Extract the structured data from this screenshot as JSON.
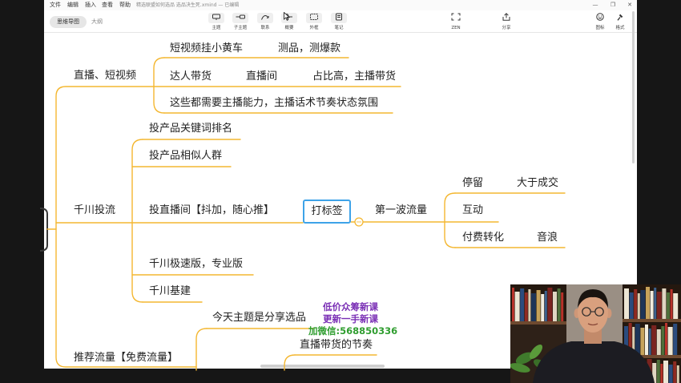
{
  "window": {
    "menu": [
      "文件",
      "编辑",
      "插入",
      "查看",
      "帮助"
    ],
    "title": "精选联盟如何选品 选品决生死.xmind — 已编辑",
    "controls": {
      "minimize": "—",
      "maximize": "❐",
      "close": "✕"
    }
  },
  "view_tabs": {
    "mindmap": "思维导图",
    "outline": "大纲"
  },
  "toolbar": {
    "insert_tools": [
      {
        "label": "主题",
        "icon": "topic-icon"
      },
      {
        "label": "子主题",
        "icon": "subtopic-icon"
      },
      {
        "label": "联系",
        "icon": "relationship-icon"
      },
      {
        "label": "概要",
        "icon": "summary-icon"
      },
      {
        "label": "外框",
        "icon": "boundary-icon"
      },
      {
        "label": "笔记",
        "icon": "note-icon"
      }
    ],
    "zen": {
      "label": "ZEN",
      "icon": "zen-icon"
    },
    "share": {
      "label": "分享",
      "icon": "share-icon"
    },
    "icons_panel": {
      "label": "图标",
      "icon": "sticker-icon"
    },
    "format_panel": {
      "label": "格式",
      "icon": "brush-icon"
    }
  },
  "mindmap": {
    "live_short_video": {
      "label": "直播、短视频",
      "short_video_cart": {
        "label": "短视频挂小黄车",
        "child": "测品，测爆款"
      },
      "influencer": {
        "label": "达人带货",
        "child": "直播间",
        "grandchild": "占比高，主播带货"
      },
      "anchor_ability": "这些都需要主播能力，主播话术节奏状态氛围"
    },
    "qianchuan": {
      "label": "千川投流",
      "keyword_rank": "投产品关键词排名",
      "similar_audience": "投产品相似人群",
      "live_room": {
        "label": "投直播间【抖加，随心推】",
        "tag": "打标签",
        "first_wave": {
          "label": "第一波流量",
          "stay": {
            "label": "停留",
            "child": "大于成交"
          },
          "interact": "互动",
          "paid_conversion": {
            "label": "付费转化",
            "child": "音浪"
          }
        }
      },
      "speed_pro": "千川极速版，专业版",
      "infrastructure": "千川基建"
    },
    "recommended_traffic": {
      "label": "推荐流量【免费流量】",
      "today_topic": {
        "label": "今天主题是分享选品",
        "child": "直播带货的节奏"
      }
    }
  },
  "overlay_text": [
    "低价众筹新课",
    "更新一手新课",
    "加微信:568850336"
  ],
  "colors": {
    "branch_line": "#f4b731",
    "tag_border": "#3ea3e8",
    "watermark_purple": "#7a2fb5",
    "watermark_green": "#2f9d2f",
    "canvas": "#ffffff",
    "frame": "#161616"
  }
}
